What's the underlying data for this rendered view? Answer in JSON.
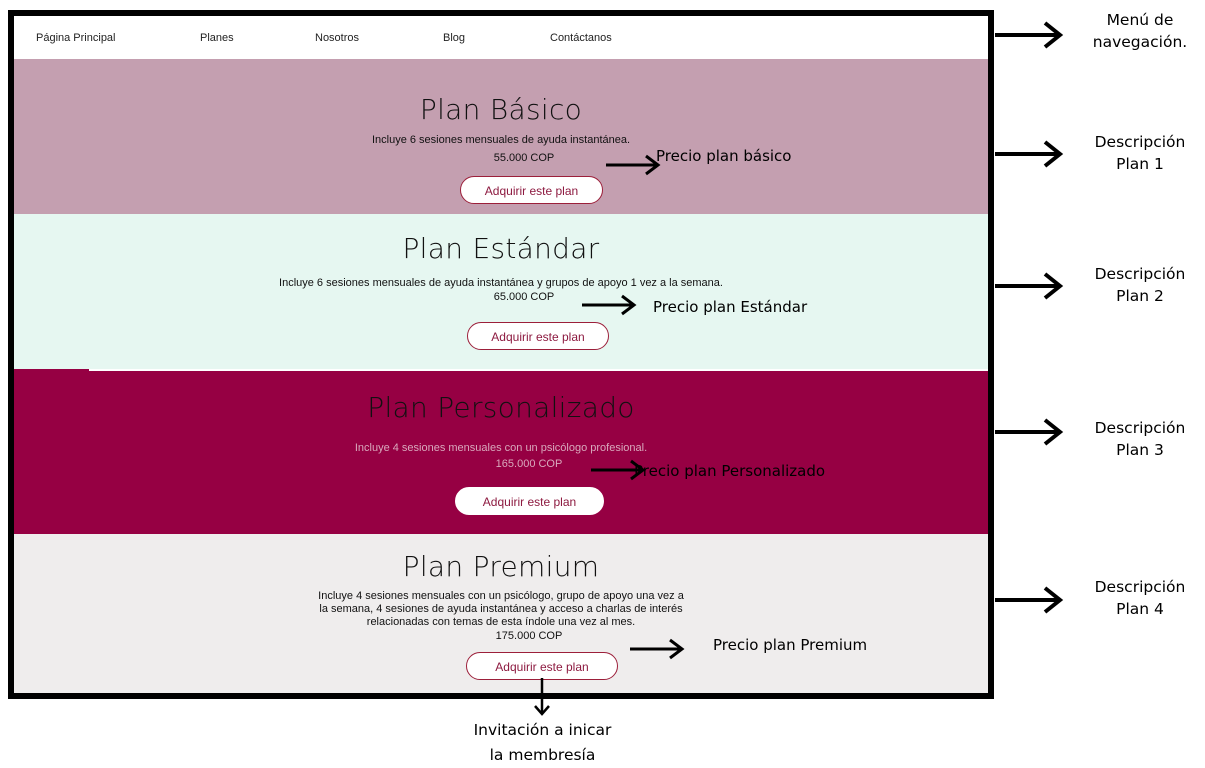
{
  "nav": {
    "items": [
      "Página Principal",
      "Planes",
      "Nosotros",
      "Blog",
      "Contáctanos"
    ]
  },
  "plans": [
    {
      "title": "Plan Básico",
      "description": [
        "Incluye 6 sesiones mensuales de ayuda instantánea."
      ],
      "price": "55.000 COP",
      "button": "Adquirir este plan",
      "price_annotation": "Precio plan básico"
    },
    {
      "title": "Plan Estándar",
      "description": [
        "Incluye 6 sesiones mensuales de ayuda instantánea y grupos de apoyo 1 vez a la semana."
      ],
      "price": "65.000 COP",
      "button": "Adquirir este plan",
      "price_annotation": "Precio plan Estándar"
    },
    {
      "title": "Plan Personalizado",
      "description": [
        "Incluye 4 sesiones mensuales con un psicólogo profesional."
      ],
      "price": "165.000 COP",
      "button": "Adquirir este plan",
      "price_annotation": "Precio plan Personalizado"
    },
    {
      "title": "Plan Premium",
      "description": [
        "Incluye 4 sesiones mensuales con un psicólogo, grupo de apoyo una vez a",
        "la semana, 4 sesiones de ayuda instantánea y acceso a charlas de interés",
        "relacionadas con temas de esta índole una vez al mes."
      ],
      "price": "175.000 COP",
      "button": "Adquirir este plan",
      "price_annotation": "Precio plan Premium"
    }
  ],
  "annotations": {
    "nav": [
      "Menú de",
      "navegación."
    ],
    "plan1": [
      "Descripción",
      "Plan 1"
    ],
    "plan2": [
      "Descripción",
      "Plan 2"
    ],
    "plan3": [
      "Descripción",
      "Plan 3"
    ],
    "plan4": [
      "Descripción",
      "Plan 4"
    ],
    "cta": [
      "Invitación a inicar",
      "la membresía"
    ]
  },
  "colors": {
    "plan_basico_bg": "#c49fb0",
    "plan_estandar_bg": "#e6f7f1",
    "plan_personalizado_bg": "#960043",
    "plan_premium_bg": "#efeded",
    "button_border": "#9c1f3a",
    "button_text": "#8d1a40"
  }
}
